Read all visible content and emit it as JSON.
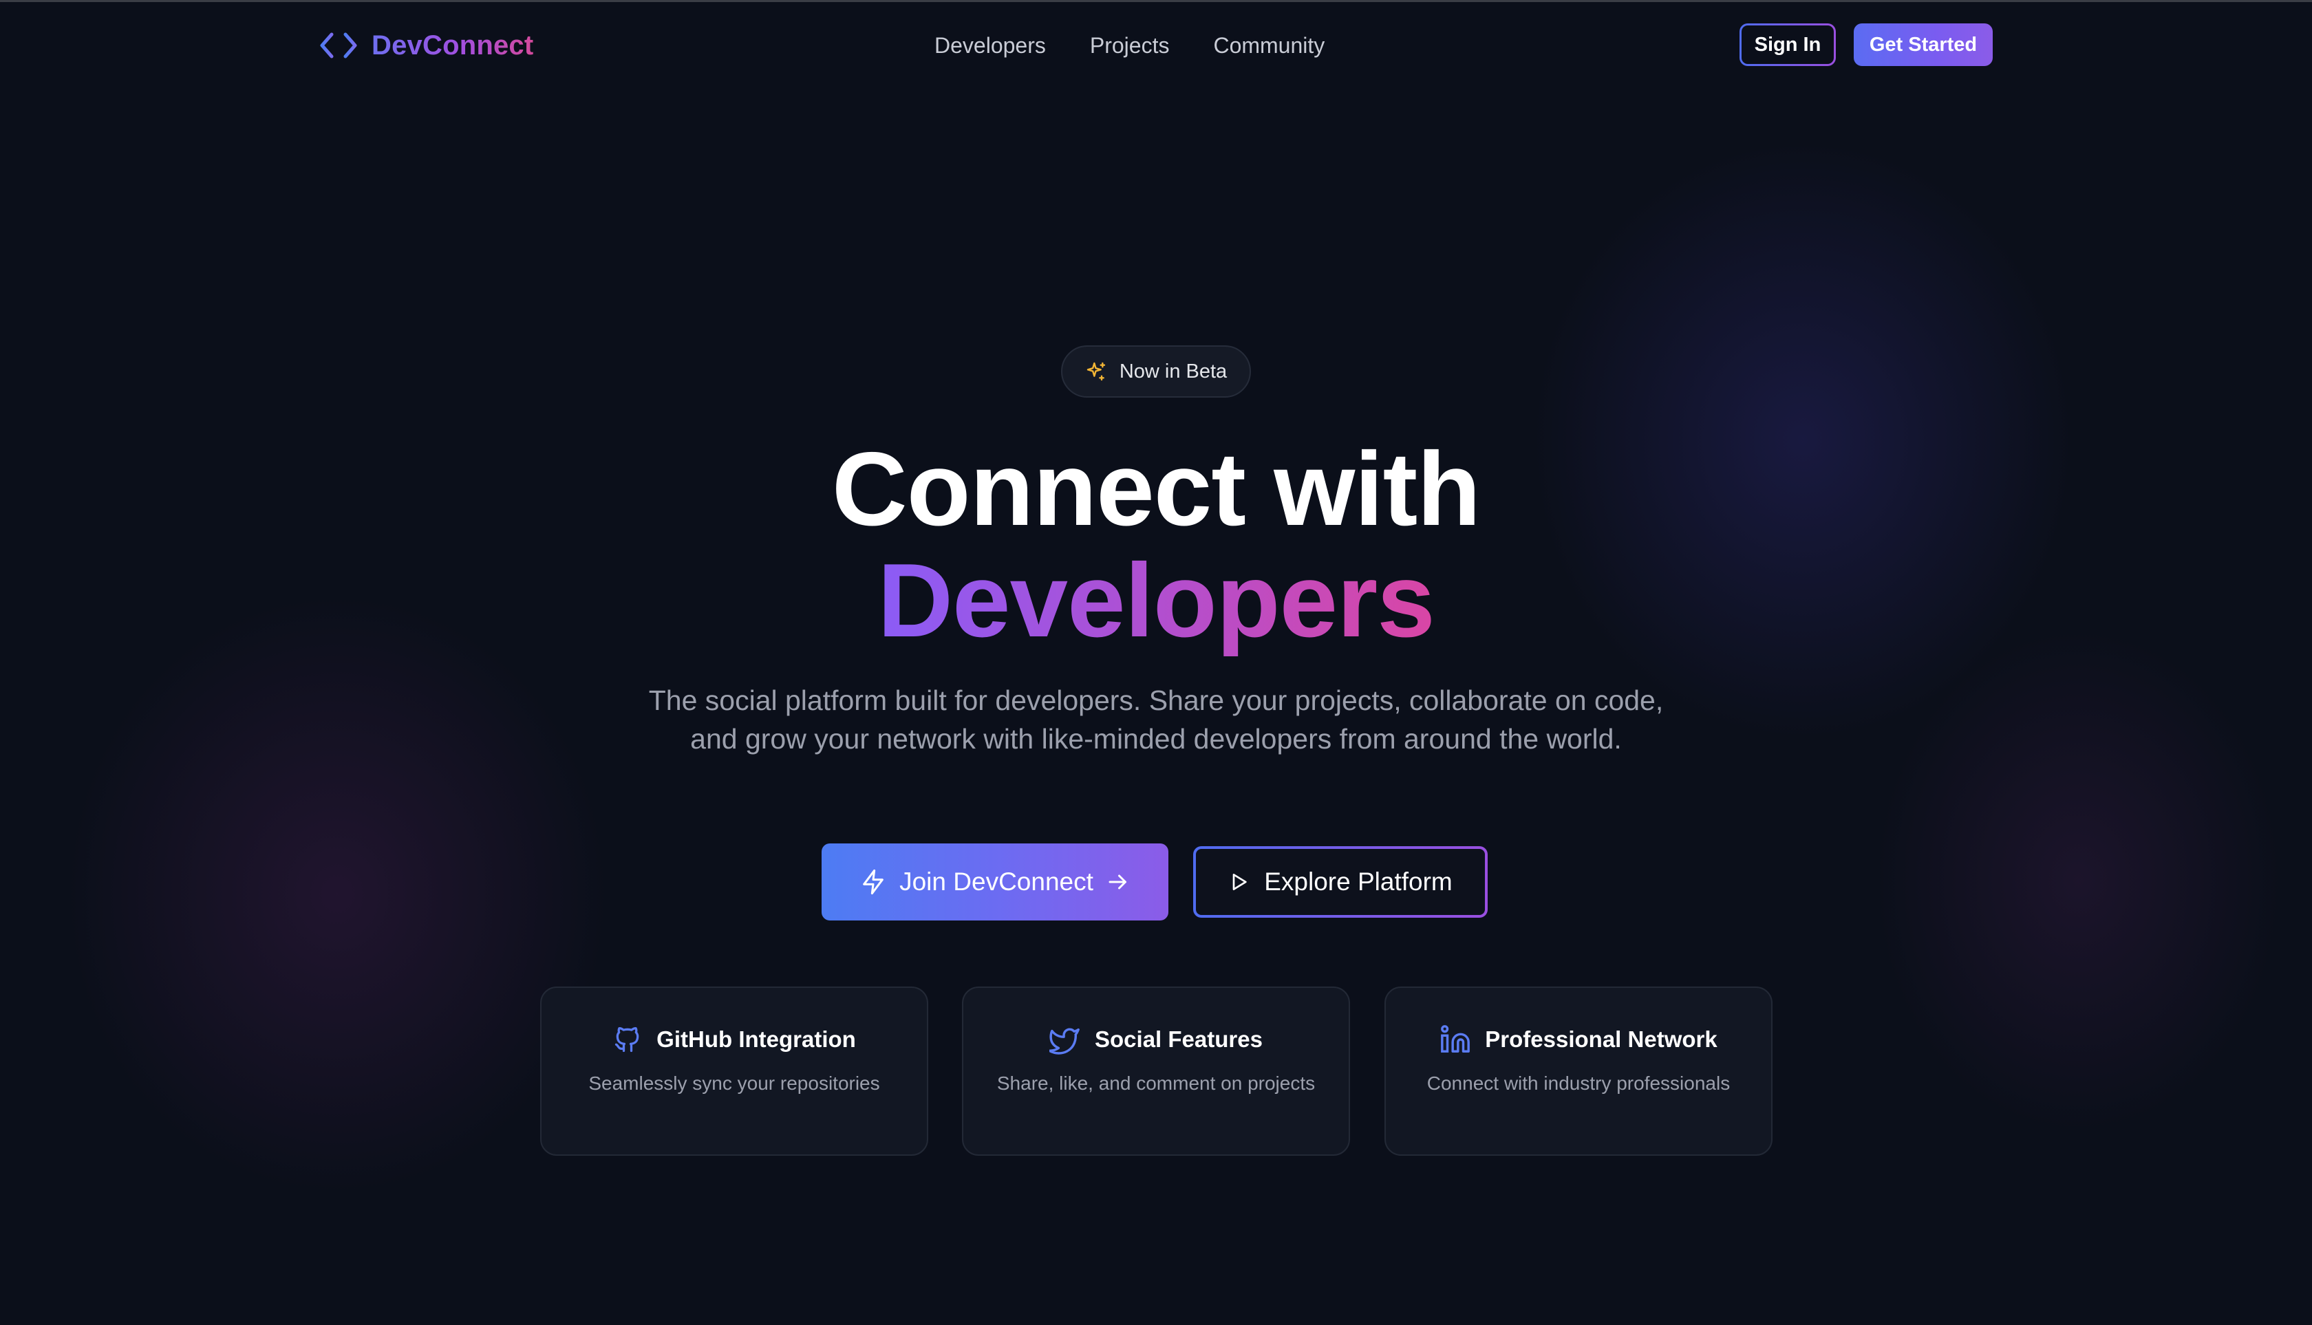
{
  "brand": {
    "name": "DevConnect",
    "logo_icon": "code-brackets-icon"
  },
  "nav": {
    "links": [
      "Developers",
      "Projects",
      "Community"
    ],
    "signin_label": "Sign In",
    "get_started_label": "Get Started"
  },
  "hero": {
    "badge_icon": "sparkles-icon",
    "badge_label": "Now in Beta",
    "title_line1": "Connect with",
    "title_line2": "Developers",
    "subtitle": "The social platform built for developers. Share your projects, collaborate on code, and grow your network with like-minded developers from around the world.",
    "primary_cta": "Join DevConnect",
    "secondary_cta": "Explore Platform"
  },
  "features": [
    {
      "icon": "github-icon",
      "title": "GitHub Integration",
      "description": "Seamlessly sync your repositories"
    },
    {
      "icon": "twitter-icon",
      "title": "Social Features",
      "description": "Share, like, and comment on projects"
    },
    {
      "icon": "linkedin-icon",
      "title": "Professional Network",
      "description": "Connect with industry professionals"
    }
  ],
  "colors": {
    "background": "#0b0f1a",
    "accent_blue": "#4d7cf3",
    "accent_purple": "#8b5cf6",
    "accent_pink": "#d946a5",
    "icon_blue": "#5b7cf3",
    "badge_icon_yellow": "#f2b535"
  }
}
